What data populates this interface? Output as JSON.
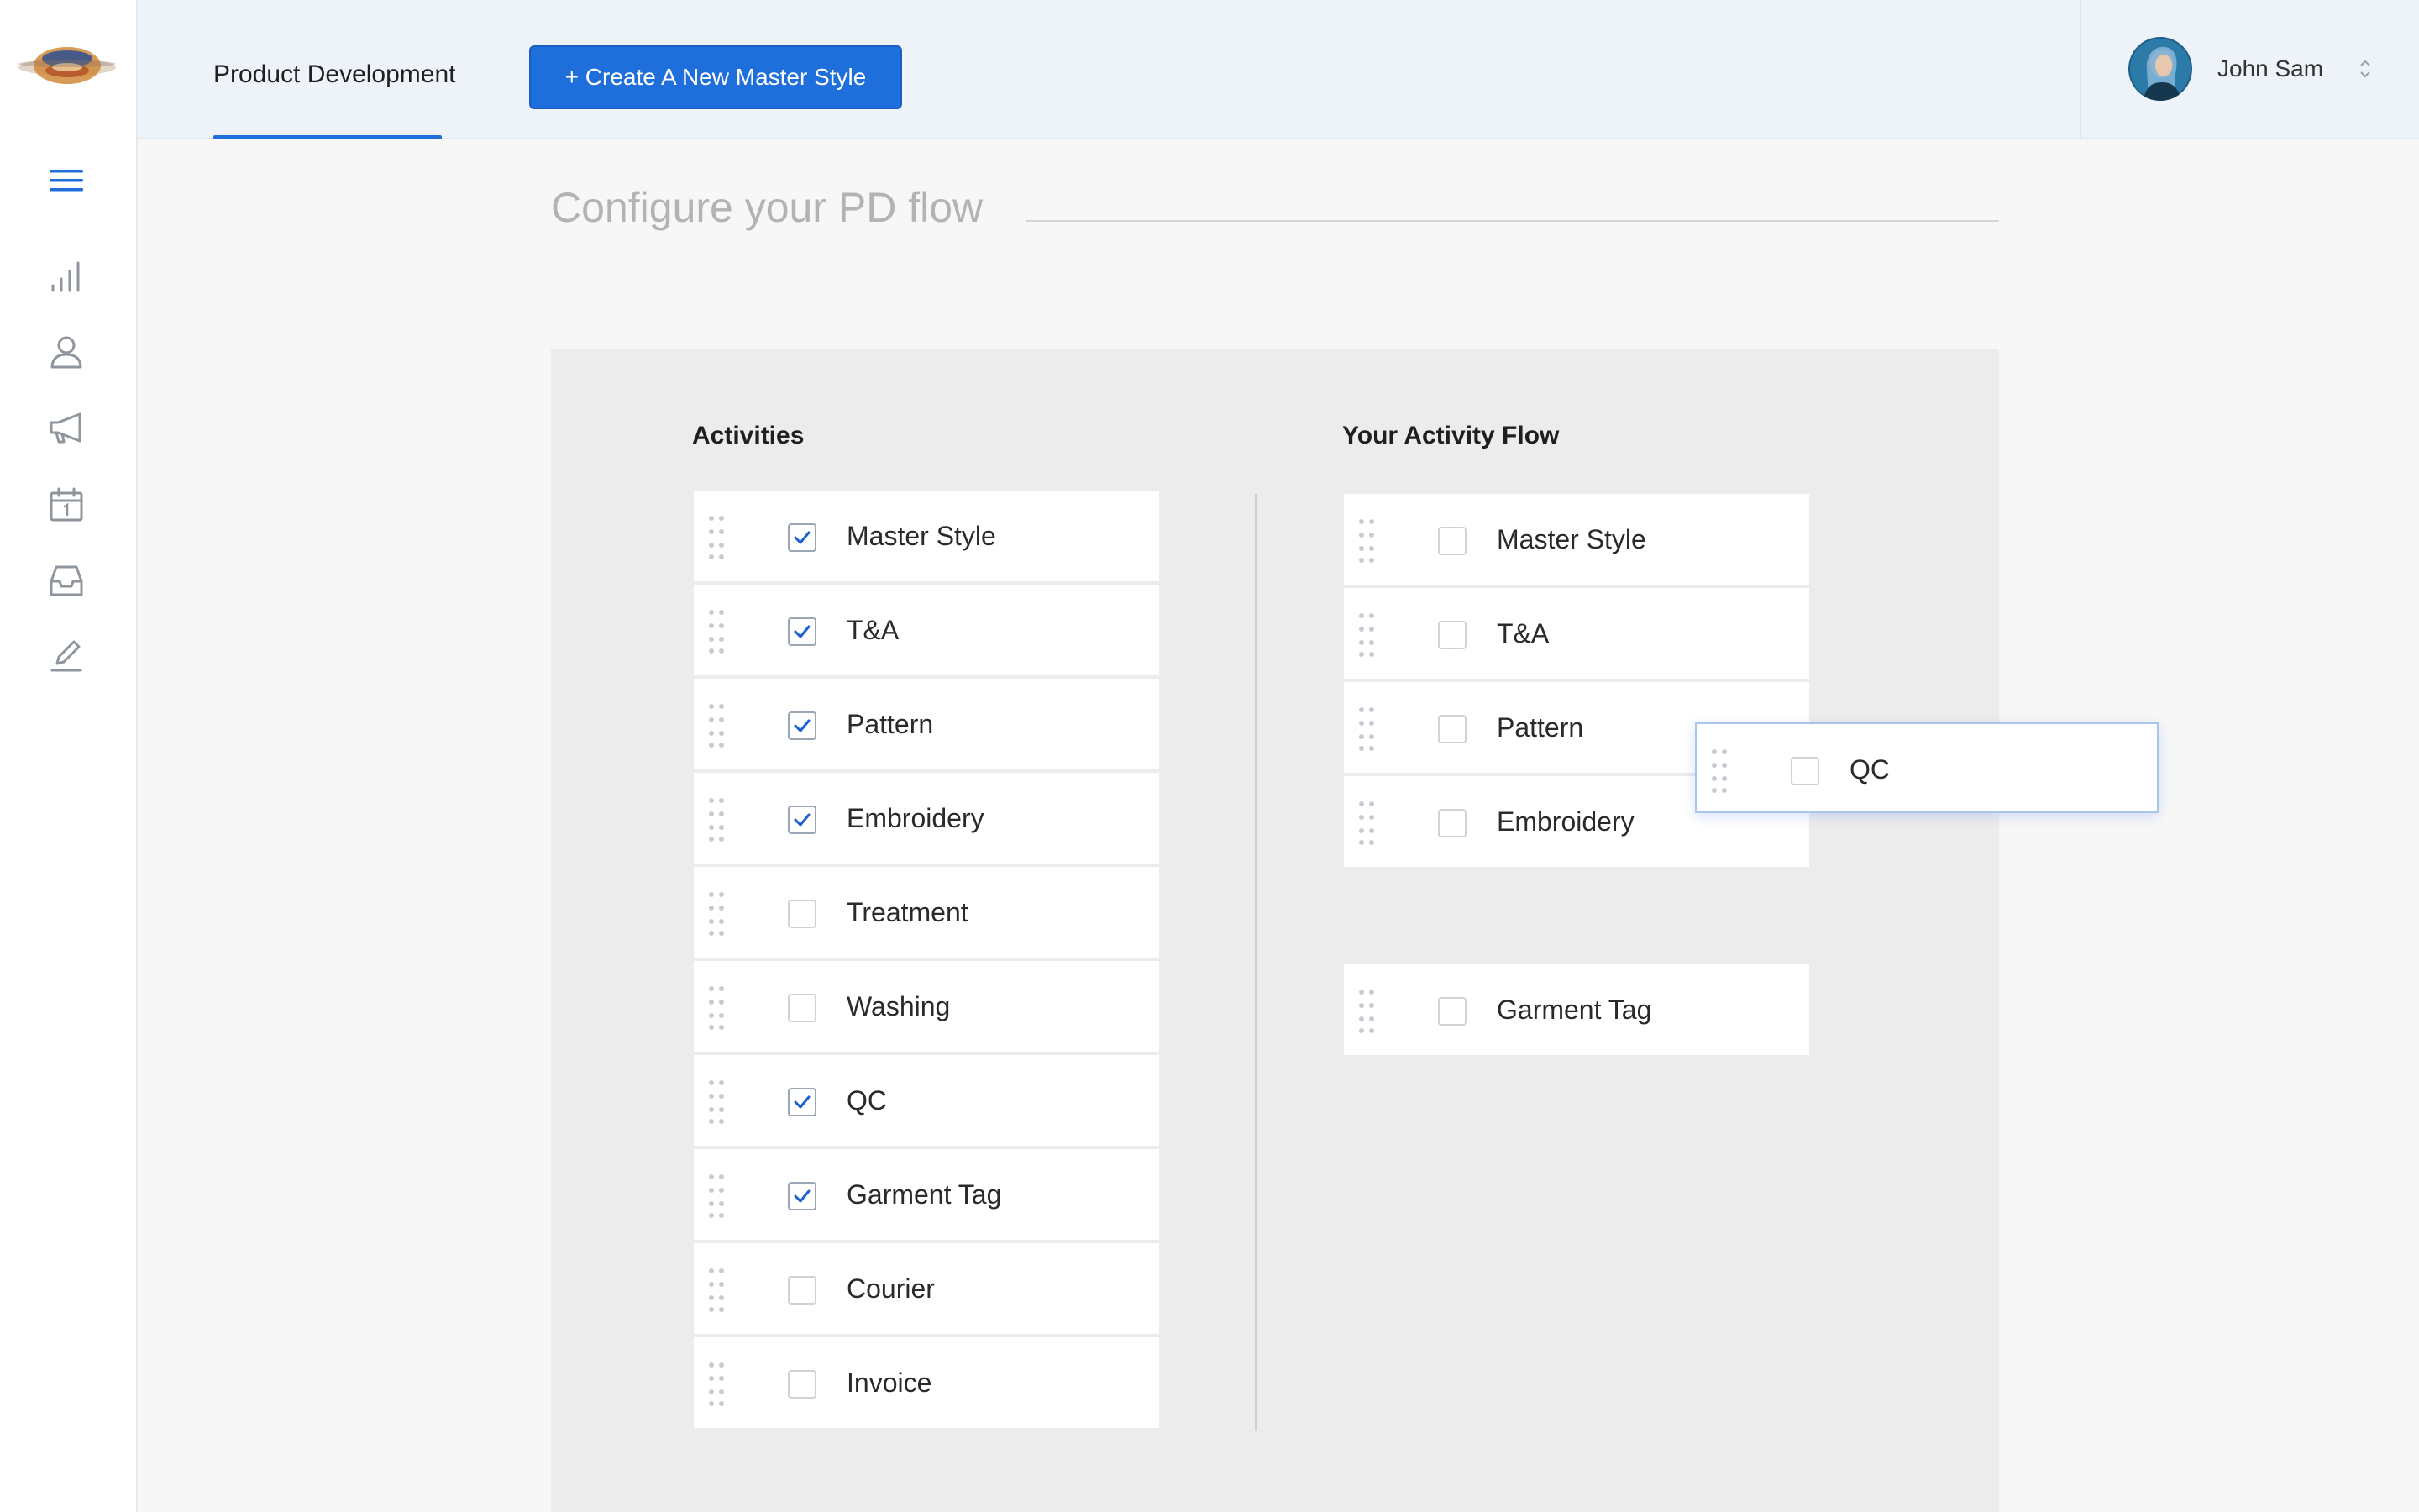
{
  "header": {
    "tab_label": "Product Development",
    "create_button_label": "+ Create A New Master Style",
    "user_name": "John Sam"
  },
  "sidebar": {
    "icons": [
      "hamburger-menu-icon",
      "bar-chart-icon",
      "user-icon",
      "megaphone-icon",
      "calendar-icon",
      "inbox-icon",
      "edit-icon"
    ]
  },
  "main": {
    "title": "Configure your PD flow",
    "activities": {
      "heading": "Activities",
      "items": [
        {
          "label": "Master Style",
          "checked": true
        },
        {
          "label": "T&A",
          "checked": true
        },
        {
          "label": "Pattern",
          "checked": true
        },
        {
          "label": "Embroidery",
          "checked": true
        },
        {
          "label": "Treatment",
          "checked": false
        },
        {
          "label": "Washing",
          "checked": false
        },
        {
          "label": "QC",
          "checked": true
        },
        {
          "label": "Garment Tag",
          "checked": true
        },
        {
          "label": "Courier",
          "checked": false
        },
        {
          "label": "Invoice",
          "checked": false
        }
      ]
    },
    "flow": {
      "heading": "Your Activity Flow",
      "items": [
        {
          "label": "Master Style",
          "checked": false
        },
        {
          "label": "T&A",
          "checked": false
        },
        {
          "label": "Pattern",
          "checked": false
        },
        {
          "label": "Embroidery",
          "checked": false
        },
        {
          "label": "Garment Tag",
          "checked": false
        }
      ],
      "dragging_item": {
        "label": "QC",
        "checked": false
      }
    }
  },
  "colors": {
    "accent": "#1e6fdc",
    "check": "#1e5fd1"
  }
}
